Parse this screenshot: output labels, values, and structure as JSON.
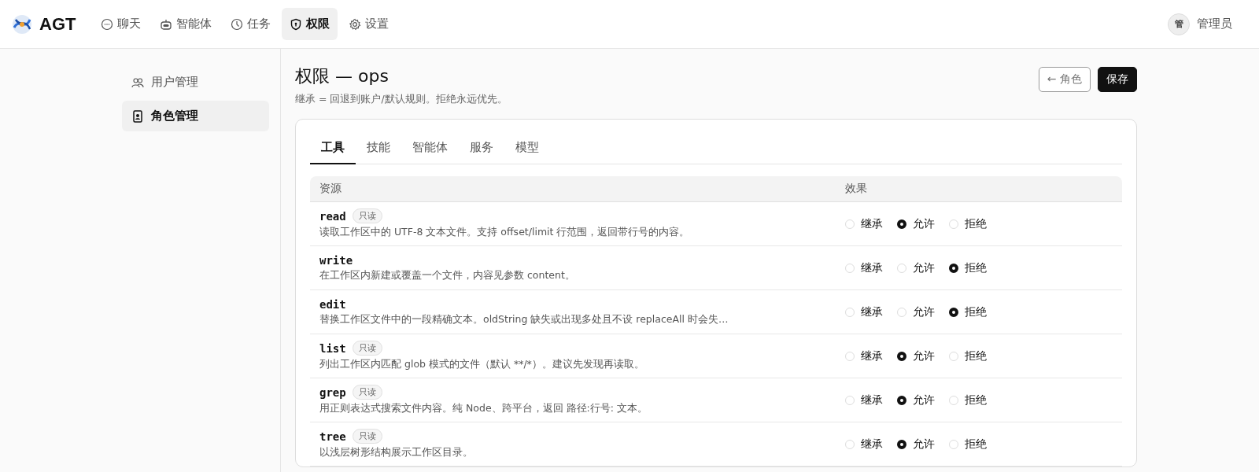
{
  "brand": {
    "name": "AGT"
  },
  "nav": [
    {
      "label": "聊天",
      "selected": false
    },
    {
      "label": "智能体",
      "selected": false
    },
    {
      "label": "任务",
      "selected": false
    },
    {
      "label": "权限",
      "selected": true
    },
    {
      "label": "设置",
      "selected": false
    }
  ],
  "user": {
    "avatar": "管",
    "name": "管理员"
  },
  "sidebar": {
    "items": [
      {
        "label": "用户管理",
        "selected": false
      },
      {
        "label": "角色管理",
        "selected": true
      }
    ]
  },
  "page": {
    "title": "权限 — ops",
    "subtitle": "继承 = 回退到账户/默认规则。拒绝永远优先。",
    "back_button": "← 角色",
    "save_button": "保存"
  },
  "tabs": [
    {
      "label": "工具",
      "selected": true
    },
    {
      "label": "技能",
      "selected": false
    },
    {
      "label": "智能体",
      "selected": false
    },
    {
      "label": "服务",
      "selected": false
    },
    {
      "label": "模型",
      "selected": false
    }
  ],
  "table": {
    "columns": [
      "资源",
      "效果"
    ],
    "rows": [
      {
        "name": "read",
        "badge": "只读",
        "description": "读取工作区中的 UTF-8 文本文件。支持 offset/limit 行范围，返回带行号的内容。",
        "options": [
          {
            "label": "继承",
            "selected": false
          },
          {
            "label": "允许",
            "selected": true
          },
          {
            "label": "拒绝",
            "selected": false
          }
        ]
      },
      {
        "name": "write",
        "description": "在工作区内新建或覆盖一个文件，内容见参数 content。",
        "options": [
          {
            "label": "继承",
            "selected": false
          },
          {
            "label": "允许",
            "selected": false
          },
          {
            "label": "拒绝",
            "selected": true
          }
        ]
      },
      {
        "name": "edit",
        "description": "替换工作区文件中的一段精确文本。oldString 缺失或出现多处且不设 replaceAll 时会失…",
        "options": [
          {
            "label": "继承",
            "selected": false
          },
          {
            "label": "允许",
            "selected": false
          },
          {
            "label": "拒绝",
            "selected": true
          }
        ]
      },
      {
        "name": "list",
        "badge": "只读",
        "description": "列出工作区内匹配 glob 模式的文件（默认 **/*）。建议先发现再读取。",
        "options": [
          {
            "label": "继承",
            "selected": false
          },
          {
            "label": "允许",
            "selected": true
          },
          {
            "label": "拒绝",
            "selected": false
          }
        ]
      },
      {
        "name": "grep",
        "badge": "只读",
        "description": "用正则表达式搜索文件内容。纯 Node、跨平台，返回 路径:行号: 文本。",
        "options": [
          {
            "label": "继承",
            "selected": false
          },
          {
            "label": "允许",
            "selected": true
          },
          {
            "label": "拒绝",
            "selected": false
          }
        ]
      },
      {
        "name": "tree",
        "badge": "只读",
        "description": "以浅层树形结构展示工作区目录。",
        "options": [
          {
            "label": "继承",
            "selected": false
          },
          {
            "label": "允许",
            "selected": true
          },
          {
            "label": "拒绝",
            "selected": false
          }
        ]
      }
    ]
  }
}
